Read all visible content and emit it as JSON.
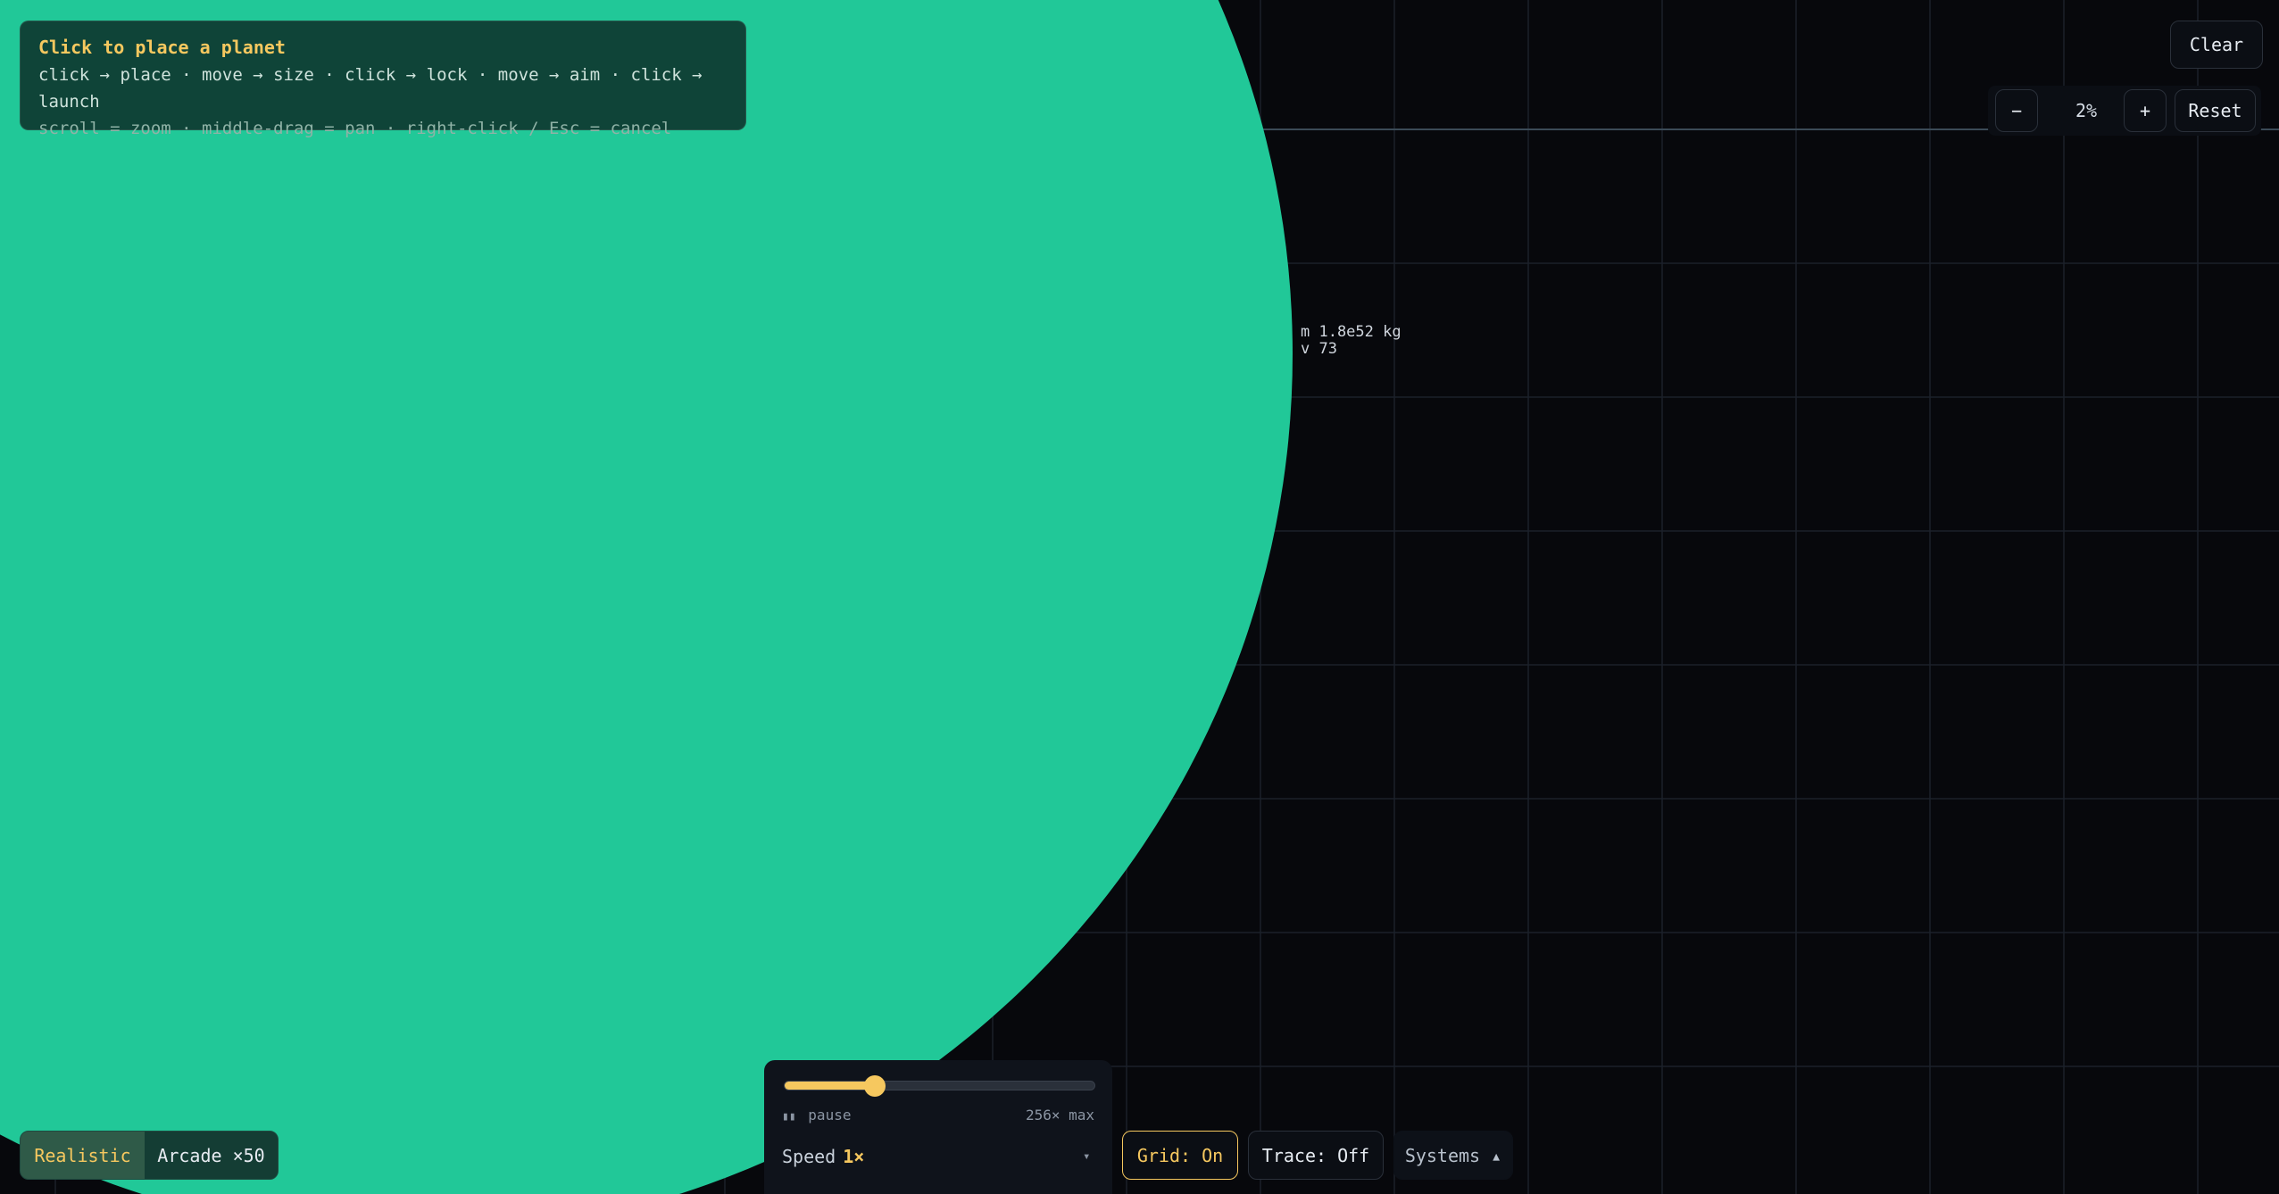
{
  "hint": {
    "title": "Click to place a planet",
    "line1": "click → place · move → size · click → lock · move → aim · click → launch",
    "line2": "scroll = zoom · middle-drag = pan · right-click / Esc = cancel"
  },
  "readout": {
    "mass": "m 1.8e52 kg",
    "velocity": "v 73"
  },
  "toolbar": {
    "clear": "Clear"
  },
  "zoom": {
    "minus": "−",
    "level": "2%",
    "plus": "+",
    "reset": "Reset"
  },
  "mode": {
    "realistic": "Realistic",
    "arcade": "Arcade ×50",
    "selected": "Realistic"
  },
  "speed": {
    "pause_label": "pause",
    "max_label": "256× max",
    "label": "Speed",
    "value": "1×",
    "slider_fraction": 0.29
  },
  "controls": {
    "grid": "Grid: On",
    "trace": "Trace: Off",
    "systems": "Systems ▴"
  },
  "colors": {
    "planet": "#21c898",
    "accent": "#f6c85f",
    "background": "#07080c"
  }
}
